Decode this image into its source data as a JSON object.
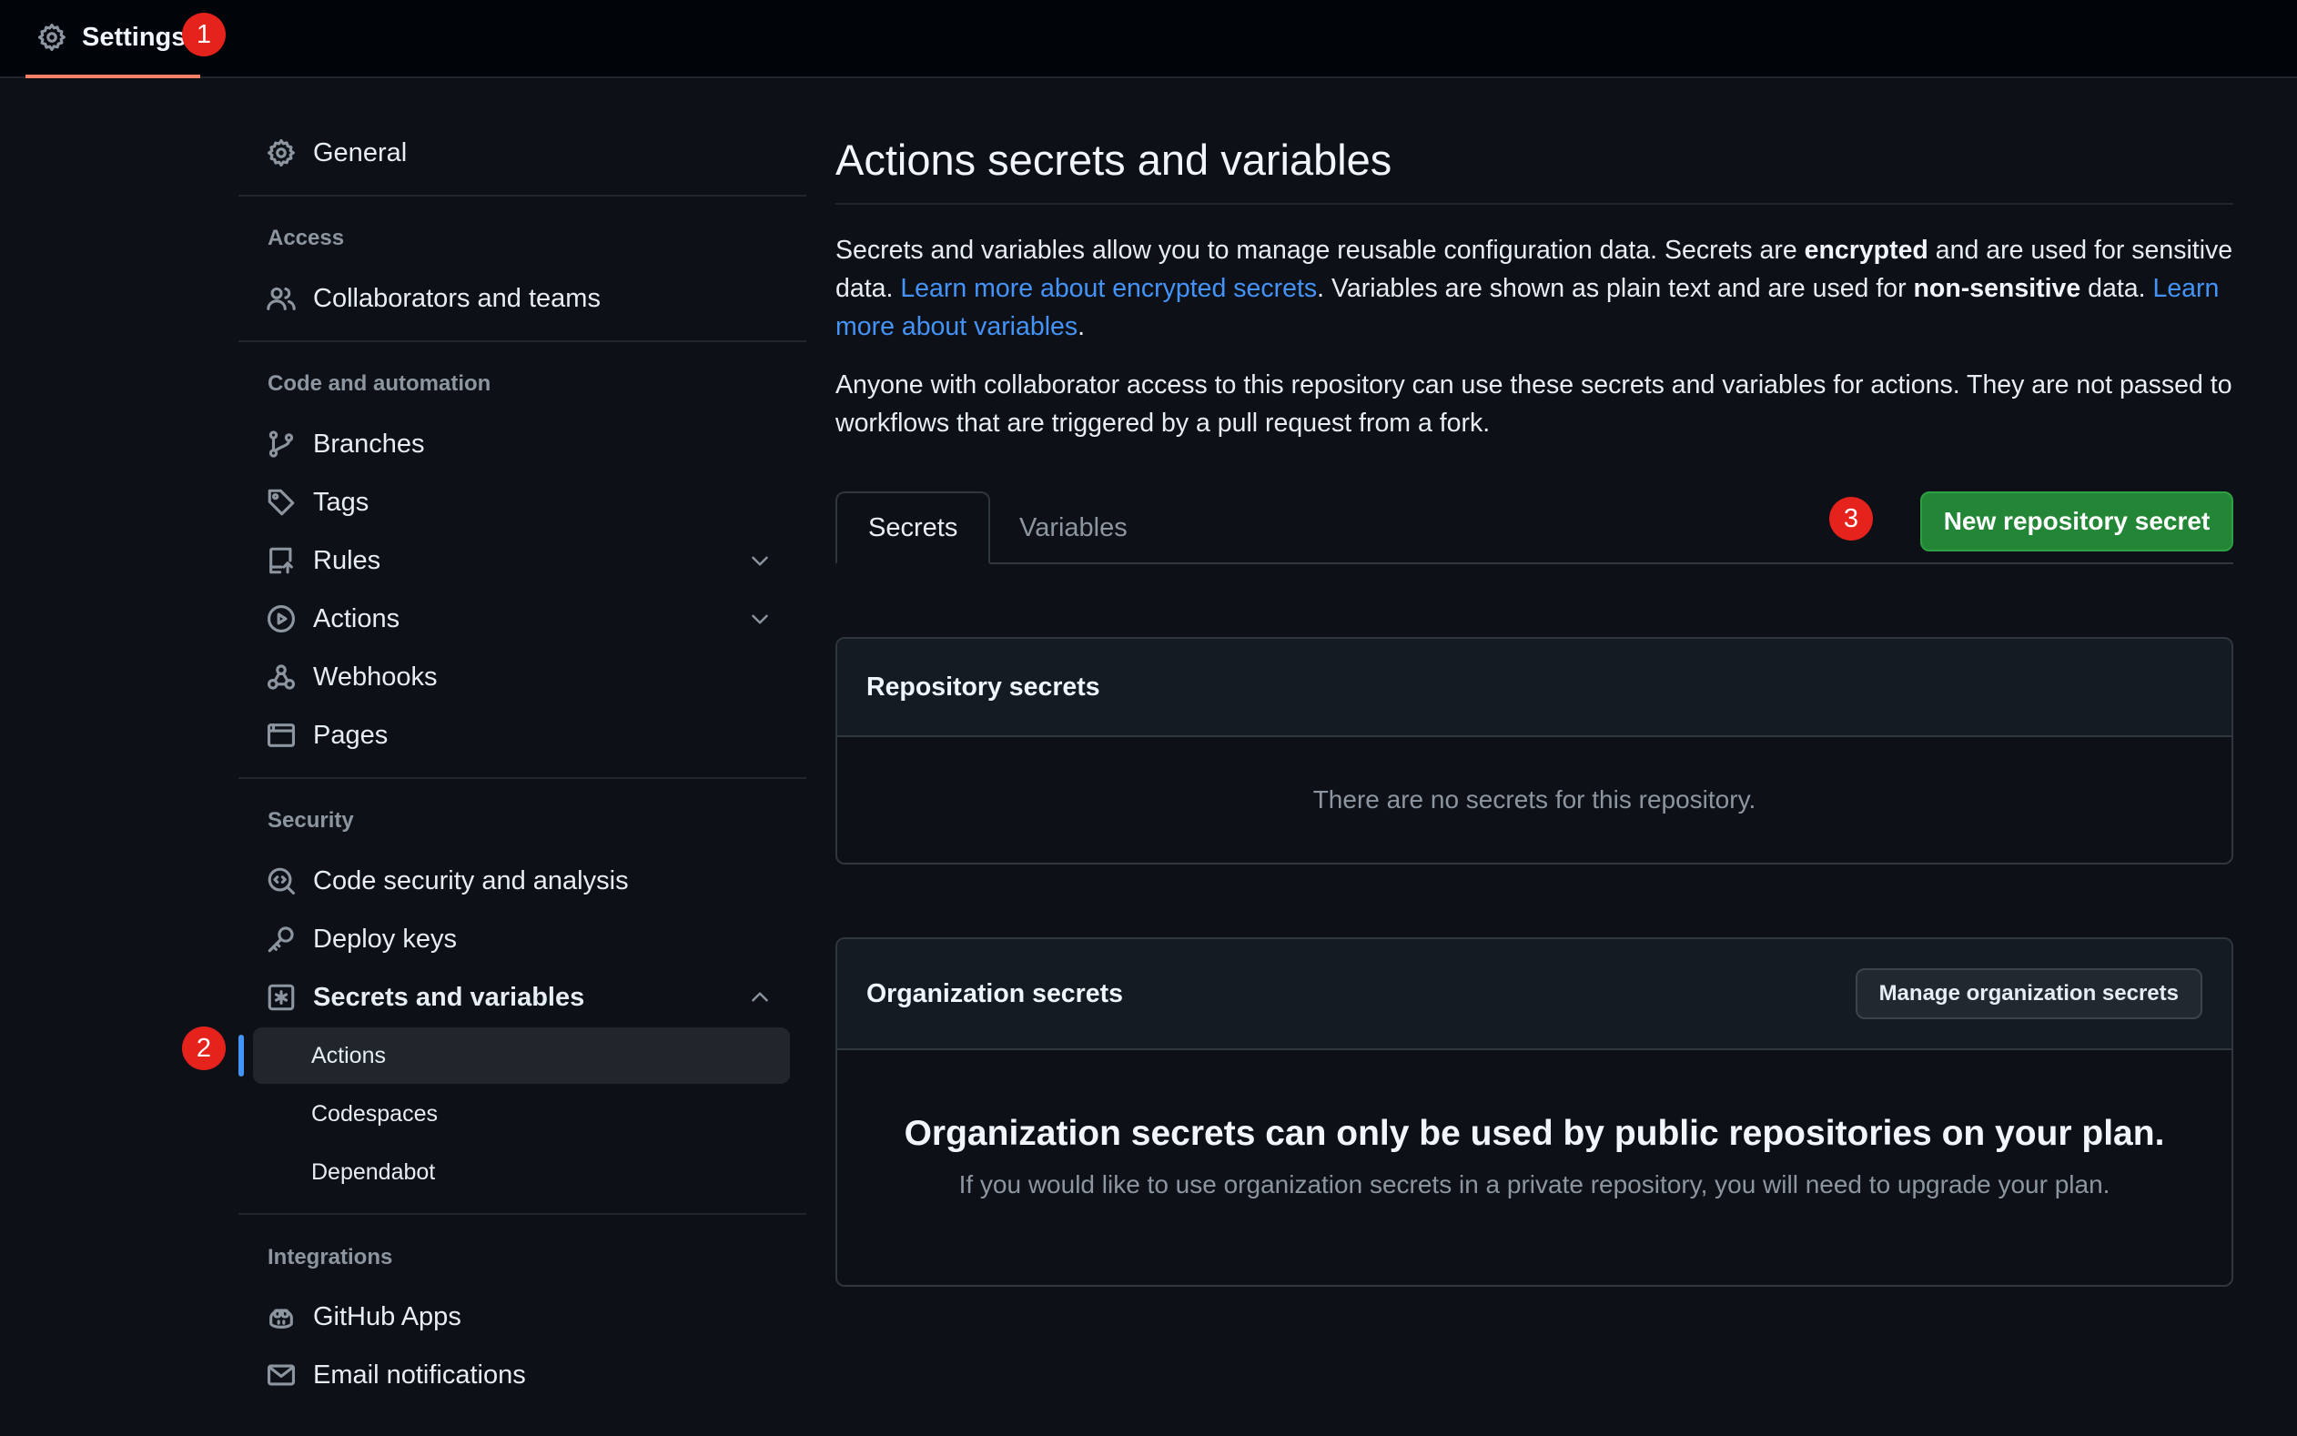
{
  "topbar": {
    "settings_label": "Settings",
    "badge": "1"
  },
  "sidebar": {
    "general": "General",
    "access_title": "Access",
    "collaborators": "Collaborators and teams",
    "code_title": "Code and automation",
    "branches": "Branches",
    "tags": "Tags",
    "rules": "Rules",
    "actions": "Actions",
    "webhooks": "Webhooks",
    "pages": "Pages",
    "security_title": "Security",
    "code_security": "Code security and analysis",
    "deploy_keys": "Deploy keys",
    "secrets_vars": "Secrets and variables",
    "sub_actions": "Actions",
    "sub_codespaces": "Codespaces",
    "sub_dependabot": "Dependabot",
    "integrations_title": "Integrations",
    "github_apps": "GitHub Apps",
    "email_notifications": "Email notifications",
    "badge": "2"
  },
  "main": {
    "title": "Actions secrets and variables",
    "desc1_a": "Secrets and variables allow you to manage reusable configuration data. Secrets are ",
    "desc1_b": "encrypted",
    "desc1_c": " and are used for sensitive data. ",
    "desc1_link1": "Learn more about encrypted secrets",
    "desc1_d": ". Variables are shown as plain text and are used for ",
    "desc1_e": "non-sensitive",
    "desc1_f": " data. ",
    "desc1_link2": "Learn more about variables",
    "desc1_g": ".",
    "desc2": "Anyone with collaborator access to this repository can use these secrets and variables for actions. They are not passed to workflows that are triggered by a pull request from a fork.",
    "tab_secrets": "Secrets",
    "tab_variables": "Variables",
    "new_secret_button": "New repository secret",
    "badge": "3",
    "repo_secrets_header": "Repository secrets",
    "repo_secrets_empty": "There are no secrets for this repository.",
    "org_secrets_header": "Organization secrets",
    "manage_org_button": "Manage organization secrets",
    "org_blank_title": "Organization secrets can only be used by public repositories on your plan.",
    "org_blank_desc": "If you would like to use organization secrets in a private repository, you will need to upgrade your plan."
  },
  "colors": {
    "background": "#0d1117",
    "accent_link": "#4493f8",
    "primary_button": "#238636",
    "annotation_badge": "#e5221b"
  }
}
